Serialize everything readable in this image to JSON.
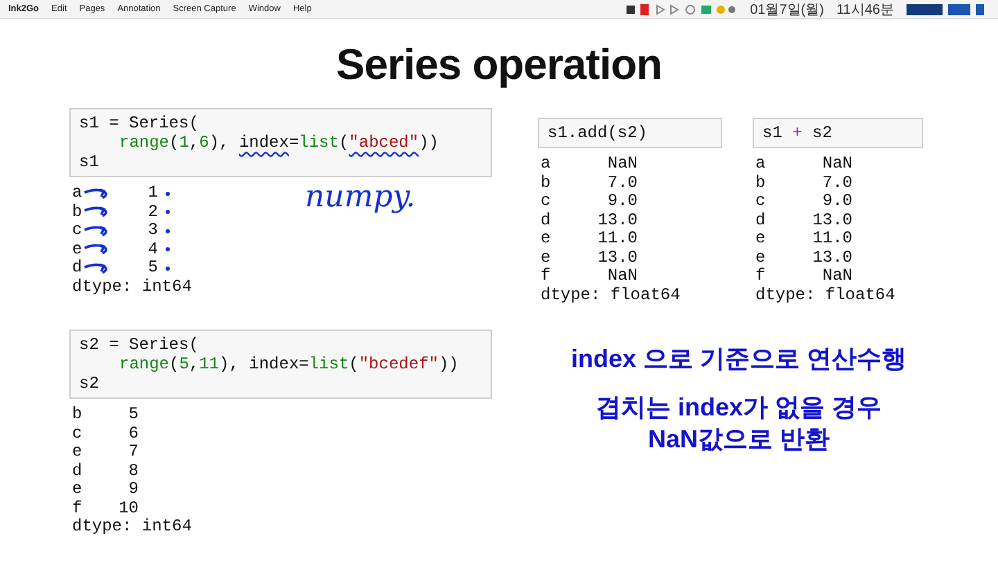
{
  "menu_bar": {
    "app": "Ink2Go",
    "items": [
      "Edit",
      "Pages",
      "Annotation",
      "Screen Capture",
      "Window",
      "Help"
    ],
    "date": "01월7일(월)",
    "time": "11시46분"
  },
  "slide": {
    "title": "Series operation",
    "left_cells": [
      {
        "code": [
          {
            "indent": false,
            "tokens": [
              {
                "kind": "plain",
                "text": "s1 = Series(",
                "underlined": false
              }
            ]
          },
          {
            "indent": true,
            "tokens": [
              {
                "kind": "builtin",
                "text": "range",
                "underlined": false
              },
              {
                "kind": "plain",
                "text": "(",
                "underlined": false
              },
              {
                "kind": "number",
                "text": "1",
                "underlined": false
              },
              {
                "kind": "plain",
                "text": ",",
                "underlined": false
              },
              {
                "kind": "number",
                "text": "6",
                "underlined": false
              },
              {
                "kind": "plain",
                "text": "), ",
                "underlined": false
              },
              {
                "kind": "plain",
                "text": "index",
                "underlined": true
              },
              {
                "kind": "plain",
                "text": "=",
                "underlined": false
              },
              {
                "kind": "builtin",
                "text": "list",
                "underlined": false
              },
              {
                "kind": "plain",
                "text": "(",
                "underlined": false
              },
              {
                "kind": "string",
                "text": "\"abced\"",
                "underlined": true
              },
              {
                "kind": "plain",
                "text": "))",
                "underlined": false
              }
            ]
          },
          {
            "indent": false,
            "tokens": [
              {
                "kind": "plain",
                "text": "s1",
                "underlined": false
              }
            ]
          }
        ],
        "rows": [
          {
            "label": "a",
            "value": "1",
            "annotated": true
          },
          {
            "label": "b",
            "value": "2",
            "annotated": true
          },
          {
            "label": "c",
            "value": "3",
            "annotated": true
          },
          {
            "label": "e",
            "value": "4",
            "annotated": true
          },
          {
            "label": "d",
            "value": "5",
            "annotated": true
          }
        ],
        "dtype": "dtype: int64",
        "note": "numpy."
      },
      {
        "code": [
          {
            "indent": false,
            "tokens": [
              {
                "kind": "plain",
                "text": "s2 = Series(",
                "underlined": false
              }
            ]
          },
          {
            "indent": true,
            "tokens": [
              {
                "kind": "builtin",
                "text": "range",
                "underlined": false
              },
              {
                "kind": "plain",
                "text": "(",
                "underlined": false
              },
              {
                "kind": "number",
                "text": "5",
                "underlined": false
              },
              {
                "kind": "plain",
                "text": ",",
                "underlined": false
              },
              {
                "kind": "number",
                "text": "11",
                "underlined": false
              },
              {
                "kind": "plain",
                "text": "), index=",
                "underlined": false
              },
              {
                "kind": "builtin",
                "text": "list",
                "underlined": false
              },
              {
                "kind": "plain",
                "text": "(",
                "underlined": false
              },
              {
                "kind": "string",
                "text": "\"bcedef\"",
                "underlined": false
              },
              {
                "kind": "plain",
                "text": "))",
                "underlined": false
              }
            ]
          },
          {
            "indent": false,
            "tokens": [
              {
                "kind": "plain",
                "text": "s2",
                "underlined": false
              }
            ]
          }
        ],
        "rows": [
          {
            "label": "b",
            "value": "5",
            "annotated": false
          },
          {
            "label": "c",
            "value": "6",
            "annotated": false
          },
          {
            "label": "e",
            "value": "7",
            "annotated": false
          },
          {
            "label": "d",
            "value": "8",
            "annotated": false
          },
          {
            "label": "e",
            "value": "9",
            "annotated": false
          },
          {
            "label": "f",
            "value": "10",
            "annotated": false
          }
        ],
        "dtype": "dtype: int64"
      }
    ],
    "right_cells": [
      {
        "code": [
          {
            "indent": false,
            "tokens": [
              {
                "kind": "plain",
                "text": "s1.add(s2)",
                "underlined": false
              }
            ]
          }
        ],
        "rows": [
          {
            "label": "a",
            "value": "NaN",
            "annotated": false
          },
          {
            "label": "b",
            "value": "7.0",
            "annotated": false
          },
          {
            "label": "c",
            "value": "9.0",
            "annotated": false
          },
          {
            "label": "d",
            "value": "13.0",
            "annotated": false
          },
          {
            "label": "e",
            "value": "11.0",
            "annotated": false
          },
          {
            "label": "e",
            "value": "13.0",
            "annotated": false
          },
          {
            "label": "f",
            "value": "NaN",
            "annotated": false
          }
        ],
        "dtype": "dtype: float64"
      },
      {
        "code": [
          {
            "indent": false,
            "tokens": [
              {
                "kind": "plain",
                "text": "s1 ",
                "underlined": false
              },
              {
                "kind": "operator",
                "text": "+",
                "underlined": false
              },
              {
                "kind": "plain",
                "text": " s2",
                "underlined": false
              }
            ]
          }
        ],
        "rows": [
          {
            "label": "a",
            "value": "NaN",
            "annotated": false
          },
          {
            "label": "b",
            "value": "7.0",
            "annotated": false
          },
          {
            "label": "c",
            "value": "9.0",
            "annotated": false
          },
          {
            "label": "d",
            "value": "13.0",
            "annotated": false
          },
          {
            "label": "e",
            "value": "11.0",
            "annotated": false
          },
          {
            "label": "e",
            "value": "13.0",
            "annotated": false
          },
          {
            "label": "f",
            "value": "NaN",
            "annotated": false
          }
        ],
        "dtype": "dtype: float64"
      }
    ],
    "notes": [
      "index 으로 기준으로 연산수행",
      "겹치는 index가 없을 경우\nNaN값으로 반환"
    ]
  }
}
